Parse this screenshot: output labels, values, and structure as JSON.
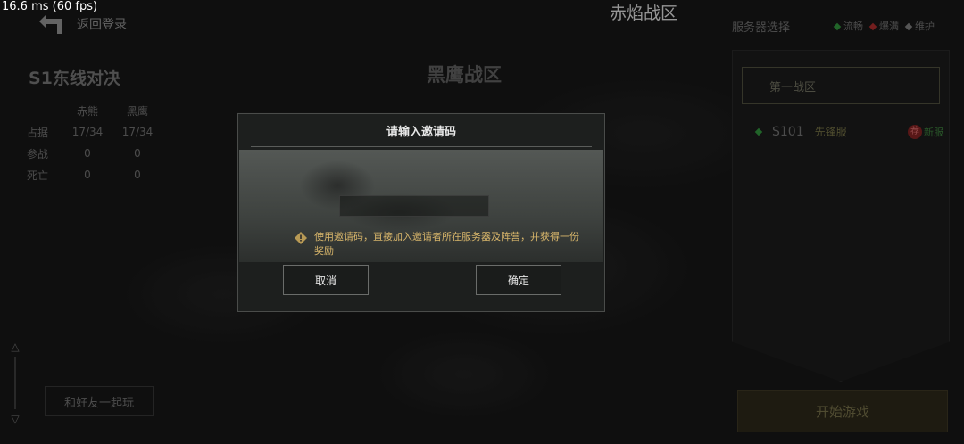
{
  "debug": {
    "fps": "16.6 ms (60 fps)"
  },
  "header": {
    "back_label": "返回登录",
    "top_title": "赤焰战区"
  },
  "left_panel": {
    "season_title": "S1东线对决",
    "columns": [
      "赤熊",
      "黑鹰"
    ],
    "rows": [
      {
        "label": "占据",
        "values": [
          "17/34",
          "17/34"
        ]
      },
      {
        "label": "参战",
        "values": [
          "0",
          "0"
        ]
      },
      {
        "label": "死亡",
        "values": [
          "0",
          "0"
        ]
      }
    ],
    "friends_button": "和好友一起玩"
  },
  "center": {
    "war_title": "黑鹰战区"
  },
  "server_panel": {
    "title": "服务器选择",
    "legend": [
      {
        "label": "流畅",
        "color": "#2e8b3a"
      },
      {
        "label": "爆满",
        "color": "#a02a2a"
      },
      {
        "label": "维护",
        "color": "#777777"
      }
    ],
    "zone": "第一战区",
    "server": {
      "id": "S101",
      "name": "先锋服",
      "rec": "荐",
      "tag": "新服"
    },
    "start_button": "开始游戏"
  },
  "dialog": {
    "title": "请输入邀请码",
    "input_value": "",
    "tip": "使用邀请码，直接加入邀请者所在服务器及阵营，并获得一份奖励",
    "cancel": "取消",
    "confirm": "确定"
  }
}
